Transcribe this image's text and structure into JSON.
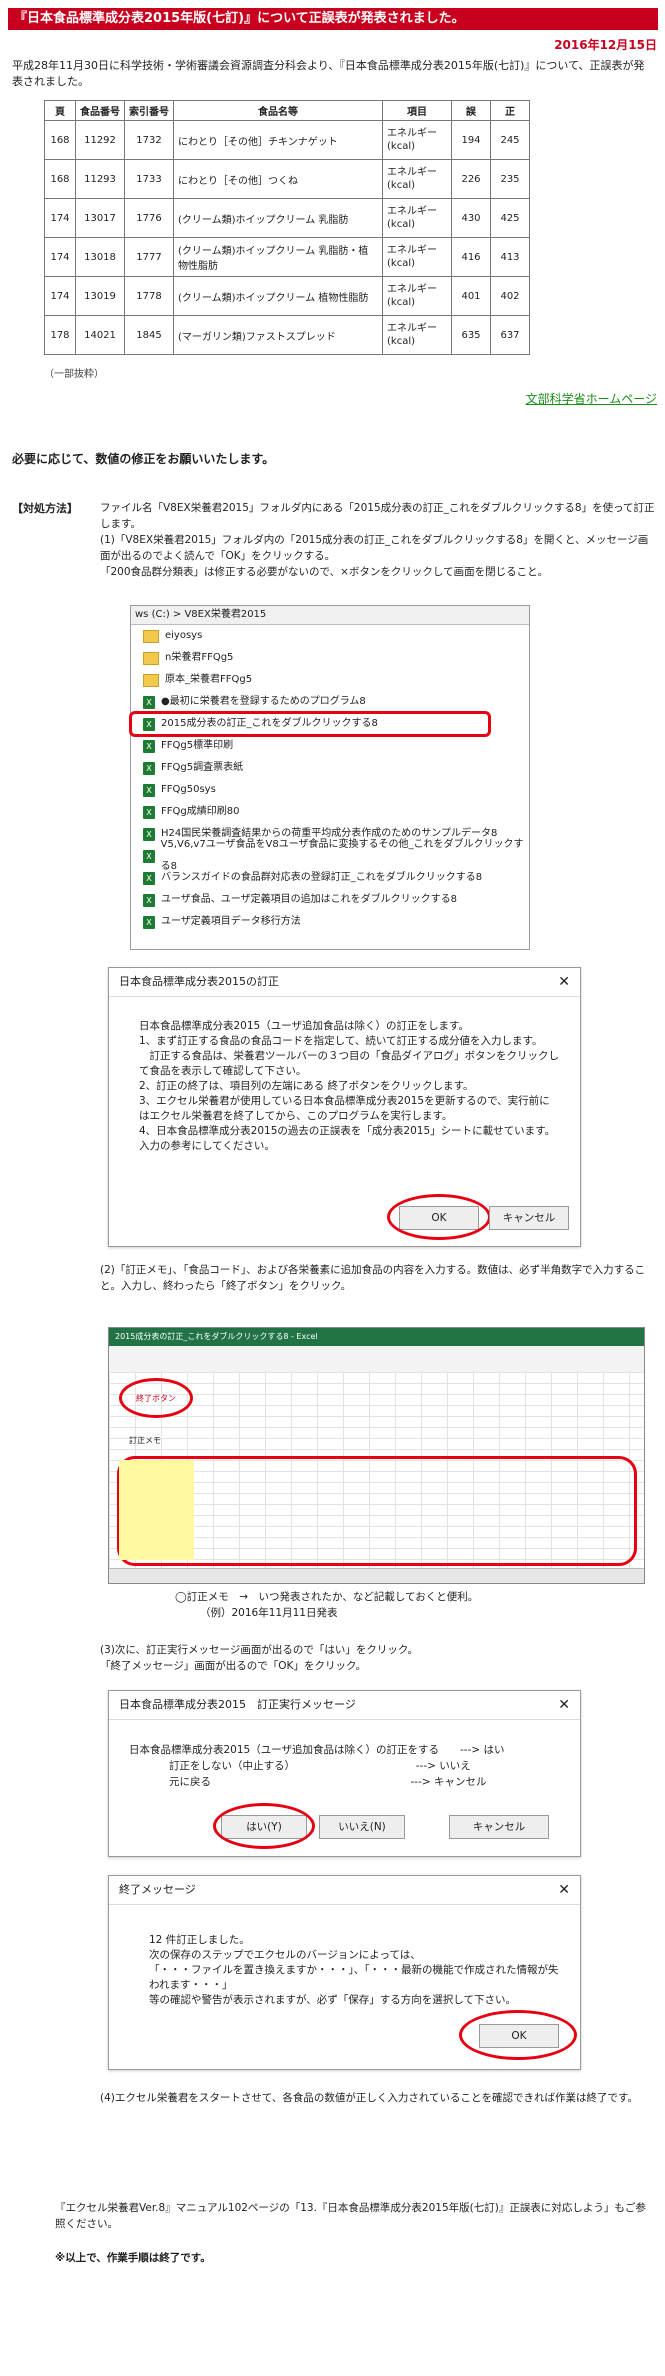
{
  "title": "『日本食品標準成分表2015年版(七訂)』について正誤表が発表されました。",
  "date": "2016年12月15日",
  "intro": "平成28年11月30日に科学技術・学術審議会資源調査分科会より、『日本食品標準成分表2015年版(七訂)』について、正誤表が発表されました。",
  "table": {
    "headers": [
      "頁",
      "食品番号",
      "索引番号",
      "食品名等",
      "項目",
      "誤",
      "正"
    ],
    "rows": [
      [
        "168",
        "11292",
        "1732",
        "にわとり［その他］チキンナゲット",
        "エネルギー(kcal)",
        "194",
        "245"
      ],
      [
        "168",
        "11293",
        "1733",
        "にわとり［その他］つくね",
        "エネルギー(kcal)",
        "226",
        "235"
      ],
      [
        "174",
        "13017",
        "1776",
        "(クリーム類)ホイップクリーム 乳脂肪",
        "エネルギー(kcal)",
        "430",
        "425"
      ],
      [
        "174",
        "13018",
        "1777",
        "(クリーム類)ホイップクリーム 乳脂肪・植物性脂肪",
        "エネルギー(kcal)",
        "416",
        "413"
      ],
      [
        "174",
        "13019",
        "1778",
        "(クリーム類)ホイップクリーム 植物性脂肪",
        "エネルギー(kcal)",
        "401",
        "402"
      ],
      [
        "178",
        "14021",
        "1845",
        "(マーガリン類)ファストスプレッド",
        "エネルギー(kcal)",
        "635",
        "637"
      ]
    ],
    "note": "（一部抜粋）"
  },
  "mext_link": "文部科学省ホームページ",
  "request": "必要に応じて、数値の修正をお願いいたします。",
  "method_label": "【対処方法】",
  "steps": {
    "s0": "ファイル名「V8EX栄養君2015」フォルダ内にある「2015成分表の訂正_これをダブルクリックする8」を使って訂正します。",
    "s1": "(1)「V8EX栄養君2015」フォルダ内の「2015成分表の訂正_これをダブルクリックする8」を開くと、メッセージ画面が出るのでよく読んで「OK」をクリックする。",
    "s1b": "「200食品群分類表」は修正する必要がないので、×ボタンをクリックして画面を閉じること。",
    "s2": "(2)「訂正メモ」、「食品コード」、および各栄養素に追加食品の内容を入力する。数値は、必ず半角数字で入力すること。入力し、終わったら「終了ボタン」をクリック。",
    "s2_memo": "◯訂正メモ　→　いつ発表されたか、など記載しておくと便利。",
    "s2_example": "（例）2016年11月11日発表",
    "s3": "(3)次に、訂正実行メッセージ画面が出るので「はい」をクリック。",
    "s3b": "「終了メッセージ」画面が出るので「OK」をクリック。",
    "s4": "(4)エクセル栄養君をスタートさせて、各食品の数値が正しく入力されていることを確認できれば作業は終了です。",
    "ref": "『エクセル栄養君Ver.8』マニュアル102ページの「13.『日本食品標準成分表2015年版(七訂)』正誤表に対応しよう」もご参照ください。",
    "end": "※以上で、作業手順は終了です。"
  },
  "explorer": {
    "path": "ws (C:)  >  V8EX栄養君2015",
    "items": [
      {
        "icon": "folder-icon",
        "label": "eiyosys"
      },
      {
        "icon": "folder-icon",
        "label": "n栄養君FFQg5"
      },
      {
        "icon": "folder-icon",
        "label": "原本_栄養君FFQg5"
      },
      {
        "icon": "excel-icon",
        "label": "●最初に栄養君を登録するためのプログラム8"
      },
      {
        "icon": "excel-icon",
        "label": "2015成分表の訂正_これをダブルクリックする8"
      },
      {
        "icon": "excel-icon",
        "label": "FFQg5標準印刷"
      },
      {
        "icon": "excel-icon",
        "label": "FFQg5調査票表紙"
      },
      {
        "icon": "excel-icon",
        "label": "FFQg50sys"
      },
      {
        "icon": "excel-icon",
        "label": "FFQg成績印刷80"
      },
      {
        "icon": "excel-icon",
        "label": "H24国民栄養調査結果からの荷重平均成分表作成のためのサンプルデータ8"
      },
      {
        "icon": "excel-icon",
        "label": "V5,V6,v7ユーザ食品をV8ユーザ食品に変換するその他_これをダブルクリックする8"
      },
      {
        "icon": "excel-icon",
        "label": "バランスガイドの食品群対応表の登録訂正_これをダブルクリックする8"
      },
      {
        "icon": "excel-icon",
        "label": "ユーザ食品、ユーザ定義項目の追加はこれをダブルクリックする8"
      },
      {
        "icon": "excel-icon",
        "label": "ユーザ定義項目データ移行方法"
      }
    ]
  },
  "dialog1": {
    "title": "日本食品標準成分表2015の訂正",
    "lines": [
      "日本食品標準成分表2015（ユーザ追加食品は除く）の訂正をします。",
      "1、まず訂正する食品の食品コードを指定して、続いて訂正する成分値を入力します。",
      "　訂正する食品は、栄養君ツールバーの３つ目の「食品ダイアログ」ボタンをクリックして食品を表示して確認して下さい。",
      "2、訂正の終了は、項目列の左端にある 終了ボタンをクリックします。",
      "3、エクセル栄養君が使用している日本食品標準成分表2015を更新するので、実行前にはエクセル栄養君を終了してから、このプログラムを実行します。",
      "4、日本食品標準成分表2015の過去の正誤表を「成分表2015」シートに載せています。入力の参考にしてください。"
    ],
    "ok": "OK",
    "cancel": "キャンセル"
  },
  "excel": {
    "title": "2015成分表の訂正_これをダブルクリックする8 - Excel",
    "end_button": "終了ボタン",
    "memo_header": "訂正メモ"
  },
  "dialog2": {
    "title": "日本食品標準成分表2015　訂正実行メッセージ",
    "line1": "日本食品標準成分表2015（ユーザ追加食品は除く）の訂正をする　　---> はい",
    "line2": "訂正をしない（中止する）　　　　　　　　　　　　---> いいえ",
    "line3": "元に戻る　　　　　　　　　　　　　　　　　　　---> キャンセル",
    "yes": "はい(Y)",
    "no": "いいえ(N)",
    "cancel": "キャンセル"
  },
  "dialog3": {
    "title": "終了メッセージ",
    "lines": [
      "12 件訂正しました。",
      "次の保存のステップでエクセルのバージョンによっては、",
      "「・・・ファイルを置き換えますか・・・」、「・・・最新の機能で作成された情報が失われます・・・」",
      "等の確認や警告が表示されますが、必ず「保存」する方向を選択して下さい。"
    ],
    "ok": "OK"
  },
  "colors": {
    "title_bg": "#c8001e",
    "highlight": "#e60012",
    "link": "#1a8f1a",
    "excel": "#217346"
  }
}
